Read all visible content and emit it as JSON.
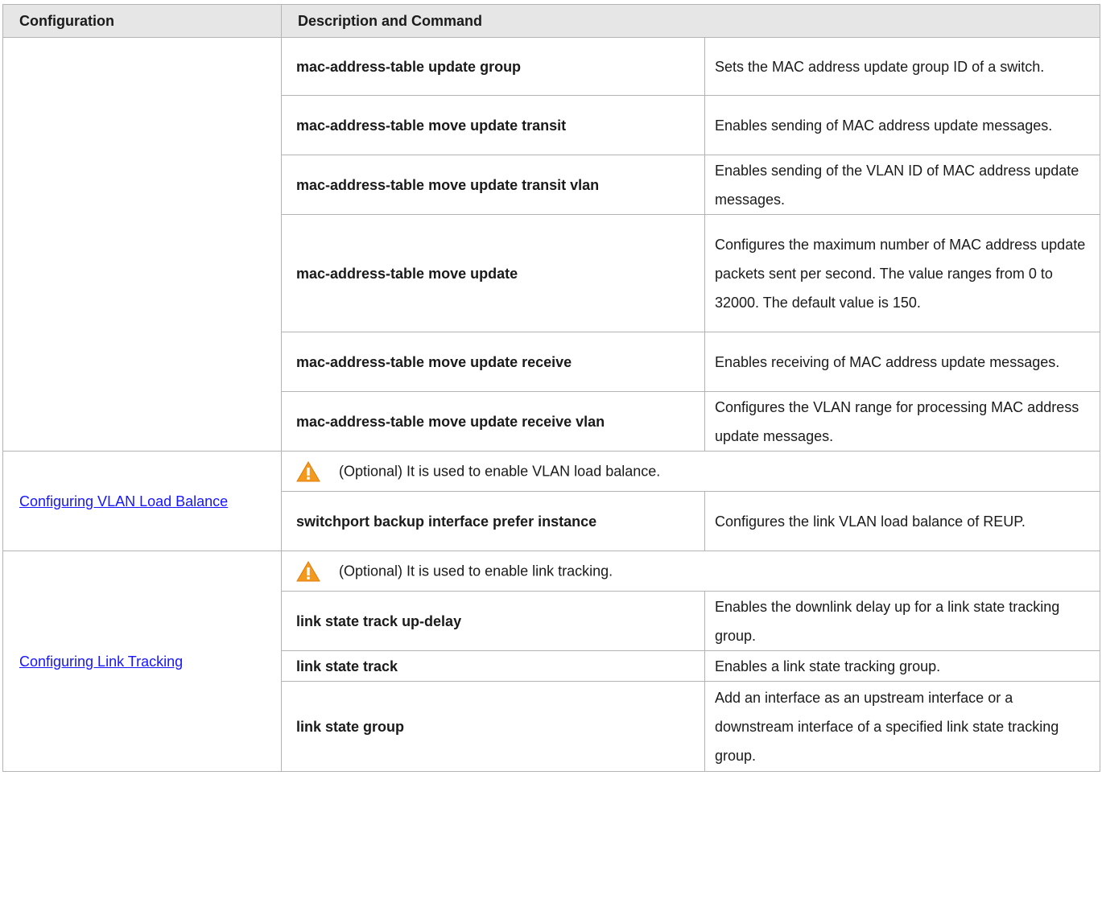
{
  "header": {
    "configuration": "Configuration",
    "description": "Description and Command"
  },
  "groups": {
    "mac_update": {
      "rows": [
        {
          "command": "mac-address-table update group",
          "description": "Sets the MAC address update group ID of a switch."
        },
        {
          "command": "mac-address-table move update transit",
          "description": "Enables sending of MAC address update messages."
        },
        {
          "command": "mac-address-table move update transit vlan",
          "description": "Enables sending of the VLAN ID of MAC address update messages."
        },
        {
          "command": "mac-address-table move update",
          "description": "Configures the maximum number of MAC address update packets sent per second. The value ranges from 0 to 32000. The default value is 150."
        },
        {
          "command": "mac-address-table move update receive",
          "description": "Enables receiving of MAC address update messages."
        },
        {
          "command": "mac-address-table move update receive vlan",
          "description": "Configures the VLAN range for processing MAC address update messages."
        }
      ]
    },
    "vlan_load_balance": {
      "link": "Configuring VLAN Load Balance",
      "note": "(Optional) It is used to enable VLAN load balance.",
      "rows": [
        {
          "command": "switchport backup interface prefer instance",
          "description": "Configures the link VLAN load balance of REUP."
        }
      ]
    },
    "link_tracking": {
      "link": "Configuring Link Tracking",
      "note": "(Optional) It is used to enable link tracking.",
      "rows": [
        {
          "command": "link state track up-delay",
          "description": "Enables the downlink delay up for a link state tracking group."
        },
        {
          "command": "link state track",
          "description": "Enables a link state tracking group."
        },
        {
          "command": "link state group",
          "description": "Add an interface as an upstream interface or a downstream interface of a specified link state tracking group."
        }
      ]
    }
  },
  "icons": {
    "warning": "warning-icon"
  },
  "colors": {
    "header_bg": "#e6e6e6",
    "link": "#1515ff",
    "warning_orange": "#f39a1e"
  }
}
